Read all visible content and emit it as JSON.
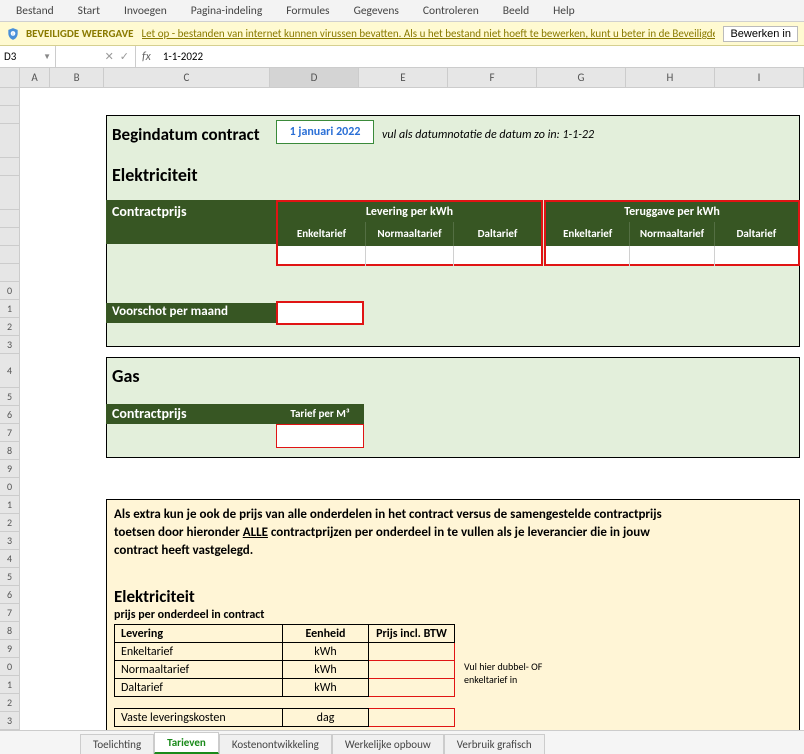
{
  "menu": [
    "Bestand",
    "Start",
    "Invoegen",
    "Pagina-indeling",
    "Formules",
    "Gegevens",
    "Controleren",
    "Beeld",
    "Help"
  ],
  "protected": {
    "title": "BEVEILIGDE WEERGAVE",
    "msg": "Let op - bestanden van internet kunnen virussen bevatten. Als u het bestand niet hoeft te bewerken, kunt u beter in de Beveiligde weergave blijven.",
    "button": "Bewerken in"
  },
  "namebox": "D3",
  "formula": "1-1-2022",
  "cols": [
    "A",
    "B",
    "C",
    "D",
    "E",
    "F",
    "G",
    "H",
    "I"
  ],
  "form": {
    "begindatum_label": "Begindatum contract",
    "begindatum_value": "1 januari 2022",
    "datum_hint": "vul als datumnotatie de datum zo in: 1-1-22",
    "elek_header": "Elektriciteit",
    "gas_header": "Gas",
    "contractprijs": "Contractprijs",
    "voorschot": "Voorschot per maand",
    "levering_per_kwh": "Levering per kWh",
    "teruggave_per_kwh": "Teruggave per kWh",
    "enkeltarief": "Enkeltarief",
    "normaaltarief": "Normaaltarief",
    "daltarief": "Daltarief",
    "tarief_m3": "Tarief per M³"
  },
  "extra": {
    "text_pre": "Als extra kun je ook de prijs van alle onderdelen in het contract versus de samengestelde contractprijs toetsen door hieronder ",
    "text_alle": "ALLE",
    "text_post": " contractprijzen per onderdeel in te vullen als je leverancier die in jouw contract heeft vastgelegd.",
    "elek_header": "Elektriciteit",
    "subtitle": "prijs per onderdeel in contract",
    "th_levering": "Levering",
    "th_eenheid": "Eenheid",
    "th_prijs": "Prijs incl. BTW",
    "rows": [
      {
        "label": "Enkeltarief",
        "unit": "kWh"
      },
      {
        "label": "Normaaltarief",
        "unit": "kWh"
      },
      {
        "label": "Daltarief",
        "unit": "kWh"
      }
    ],
    "vaste": {
      "label": "Vaste leveringskosten",
      "unit": "dag"
    },
    "vul_hint": "Vul hier dubbel- OF enkeltarief in"
  },
  "tabs": [
    "Toelichting",
    "Tarieven",
    "Kostenontwikkeling",
    "Werkelijke opbouw",
    "Verbruik grafisch"
  ],
  "active_tab": 1
}
